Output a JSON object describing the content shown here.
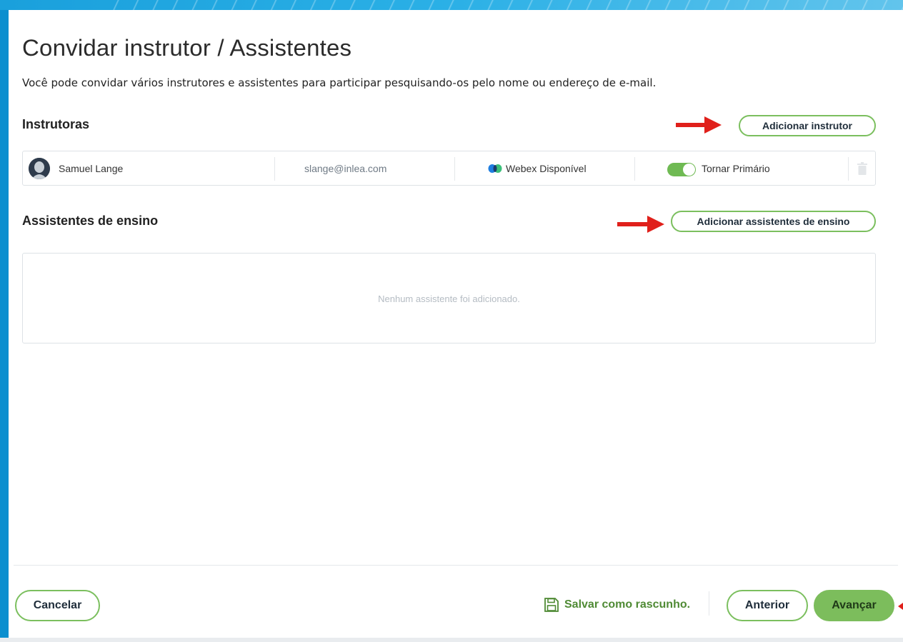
{
  "page": {
    "title": "Convidar instrutor / Assistentes",
    "subtitle": "Você pode convidar vários instrutores e assistentes para participar pesquisando-os pelo nome ou endereço de e-mail."
  },
  "instructors": {
    "heading": "Instrutoras",
    "add_button": "Adicionar instrutor",
    "rows": [
      {
        "name": "Samuel Lange",
        "email": "slange@inlea.com",
        "status": "Webex Disponível",
        "primary_toggle_label": "Tornar Primário",
        "primary_toggle_on": true
      }
    ]
  },
  "assistants": {
    "heading": "Assistentes de ensino",
    "add_button": "Adicionar assistentes de ensino",
    "empty_message": "Nenhum assistente foi adicionado."
  },
  "footer": {
    "cancel": "Cancelar",
    "save_draft": "Salvar como rascunho.",
    "previous": "Anterior",
    "next": "Avançar"
  },
  "colors": {
    "accent_green": "#7cbd5c",
    "annotation_red": "#e0201b",
    "background_blue": "#0b8fcf"
  },
  "icons": {
    "avatar": "person-avatar-icon",
    "webex": "webex-logo-icon",
    "trash": "trash-icon",
    "save": "floppy-disk-icon",
    "annotation": "red-arrow-icon"
  }
}
